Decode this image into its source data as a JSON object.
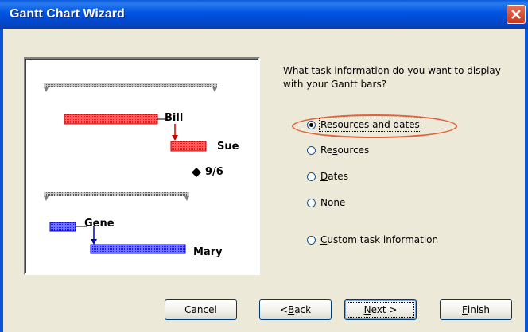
{
  "window": {
    "title": "Gantt Chart Wizard",
    "close_icon": "close-x-icon"
  },
  "colors": {
    "title_bar": "#0053E1",
    "red_bar": "#F06060",
    "blue_bar": "#5A5AE8",
    "highlight": "#E0623A"
  },
  "preview": {
    "labels": {
      "bill": "Bill",
      "sue": "Sue",
      "milestone_date": "9/6",
      "gene": "Gene",
      "mary": "Mary"
    },
    "milestone_icon": "diamond-icon"
  },
  "question": "What task information do you want to display with your Gantt bars?",
  "options": [
    {
      "pre": "",
      "acc": "R",
      "post": "esources and dates",
      "checked": true
    },
    {
      "pre": "Re",
      "acc": "s",
      "post": "ources",
      "checked": false
    },
    {
      "pre": "",
      "acc": "D",
      "post": "ates",
      "checked": false
    },
    {
      "pre": "N",
      "acc": "o",
      "post": "ne",
      "checked": false
    },
    {
      "pre": "",
      "acc": "C",
      "post": "ustom task information",
      "checked": false
    }
  ],
  "buttons": {
    "cancel": {
      "pre": "Cancel",
      "acc": "",
      "post": ""
    },
    "back": {
      "pre": "< ",
      "acc": "B",
      "post": "ack"
    },
    "next": {
      "pre": "",
      "acc": "N",
      "post": "ext >"
    },
    "finish": {
      "pre": "",
      "acc": "F",
      "post": "inish"
    }
  }
}
